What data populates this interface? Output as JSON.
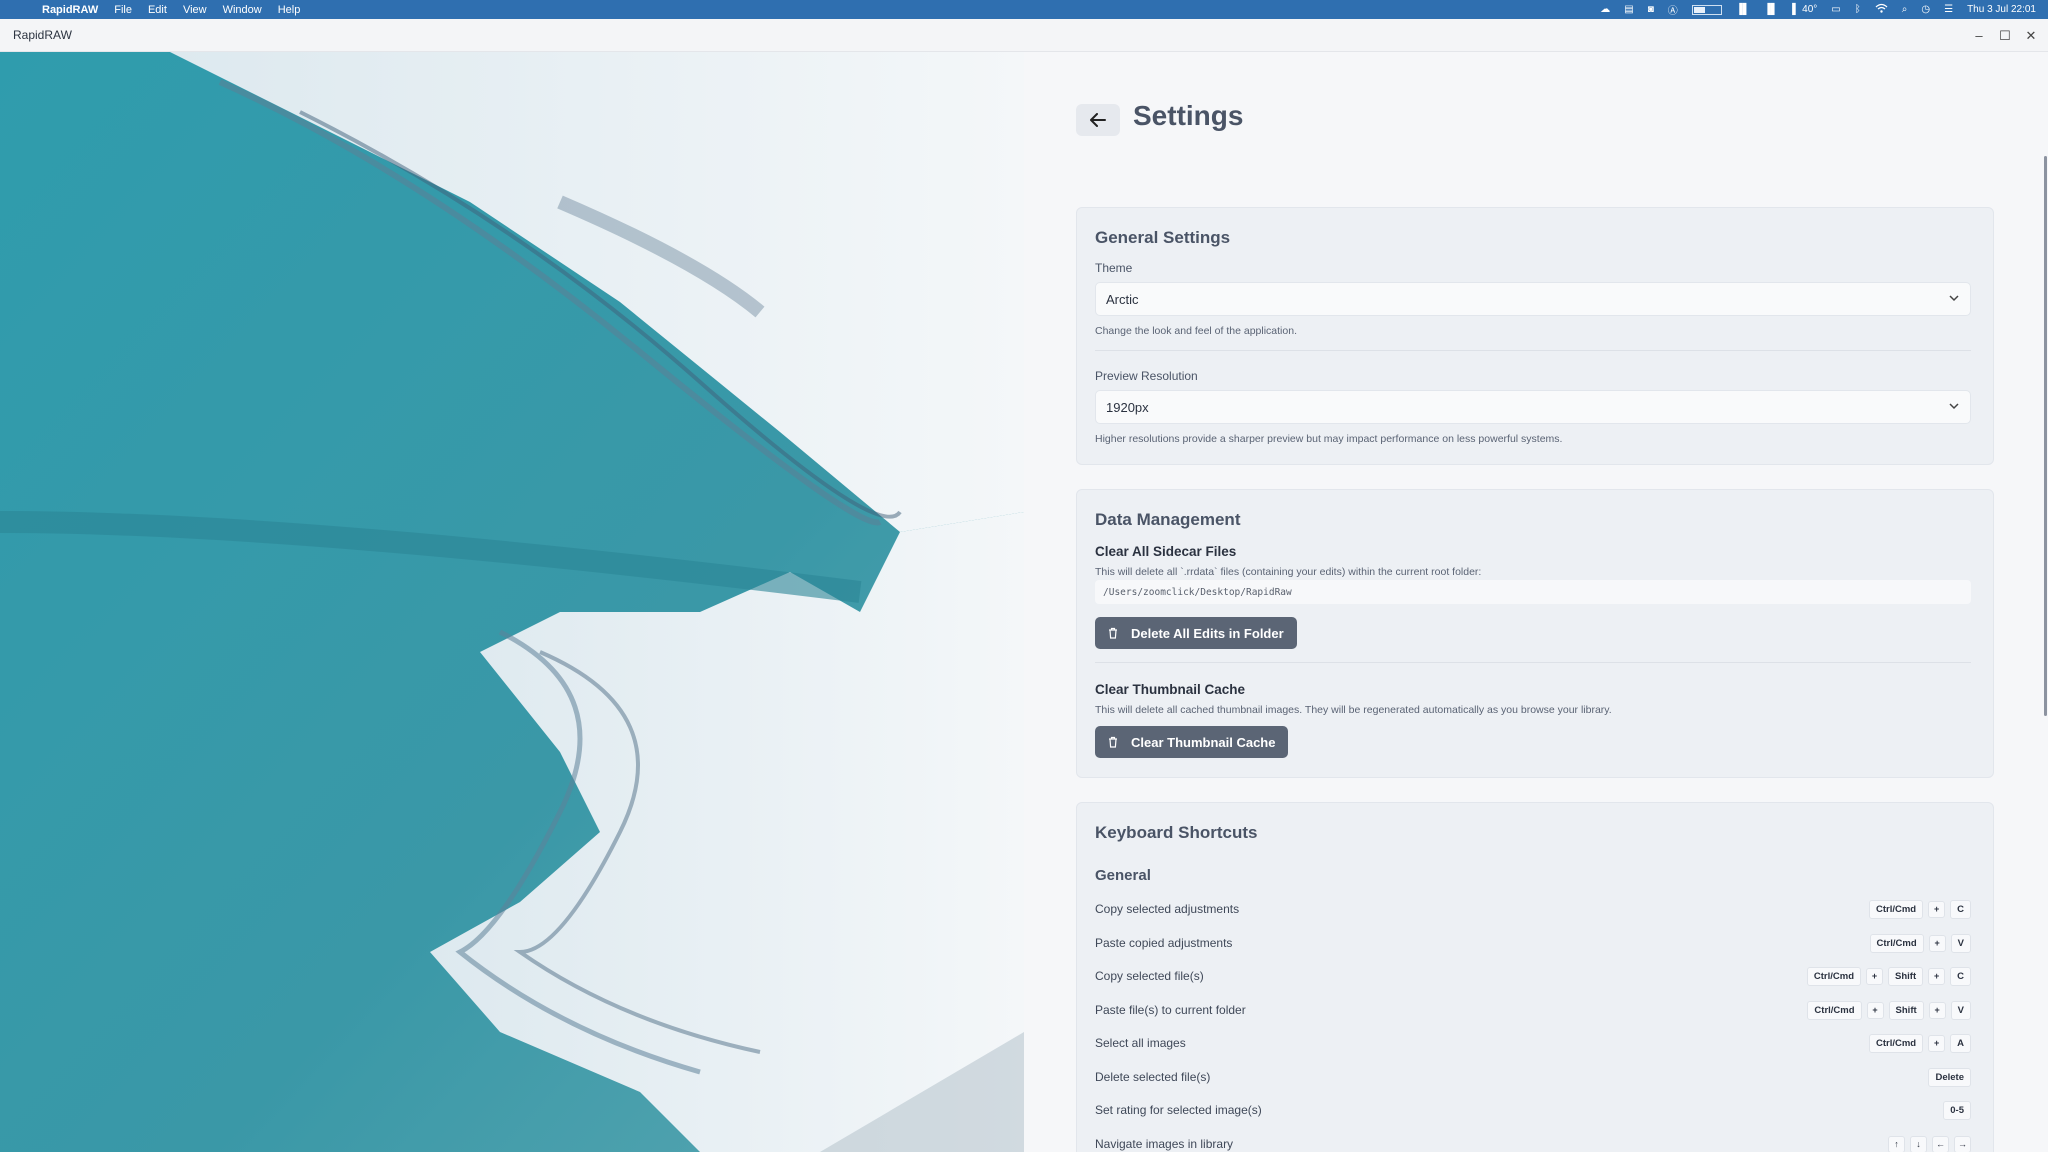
{
  "menubar": {
    "apple": "",
    "app_name": "RapidRAW",
    "menus": [
      "File",
      "Edit",
      "View",
      "Window",
      "Help"
    ],
    "temperature": "40°",
    "datetime": "Thu 3 Jul 22:01"
  },
  "window": {
    "title": "RapidRAW"
  },
  "settings": {
    "title": "Settings",
    "general": {
      "title": "General Settings",
      "theme_label": "Theme",
      "theme_value": "Arctic",
      "theme_help": "Change the look and feel of the application.",
      "preview_label": "Preview Resolution",
      "preview_value": "1920px",
      "preview_help": "Higher resolutions provide a sharper preview but may impact performance on less powerful systems."
    },
    "data": {
      "title": "Data Management",
      "sidecar_title": "Clear All Sidecar Files",
      "sidecar_help": "This will delete all `.rrdata` files (containing your edits) within the current root folder:",
      "sidecar_path": "/Users/zoomclick/Desktop/RapidRaw",
      "sidecar_button": "Delete All Edits in Folder",
      "thumb_title": "Clear Thumbnail Cache",
      "thumb_help": "This will delete all cached thumbnail images. They will be regenerated automatically as you browse your library.",
      "thumb_button": "Clear Thumbnail Cache"
    },
    "shortcuts": {
      "title": "Keyboard Shortcuts",
      "group": "General",
      "plus": "+",
      "rows": [
        {
          "label": "Copy selected adjustments",
          "keys": [
            "Ctrl/Cmd",
            "C"
          ]
        },
        {
          "label": "Paste copied adjustments",
          "keys": [
            "Ctrl/Cmd",
            "V"
          ]
        },
        {
          "label": "Copy selected file(s)",
          "keys": [
            "Ctrl/Cmd",
            "Shift",
            "C"
          ]
        },
        {
          "label": "Paste file(s) to current folder",
          "keys": [
            "Ctrl/Cmd",
            "Shift",
            "V"
          ]
        },
        {
          "label": "Select all images",
          "keys": [
            "Ctrl/Cmd",
            "A"
          ]
        },
        {
          "label": "Delete selected file(s)",
          "keys": [
            "Delete"
          ]
        },
        {
          "label": "Set rating for selected image(s)",
          "keys": [
            "0-5"
          ]
        },
        {
          "label": "Navigate images in library",
          "arrows": [
            "↑",
            "↓",
            "←",
            "→"
          ]
        }
      ]
    }
  }
}
